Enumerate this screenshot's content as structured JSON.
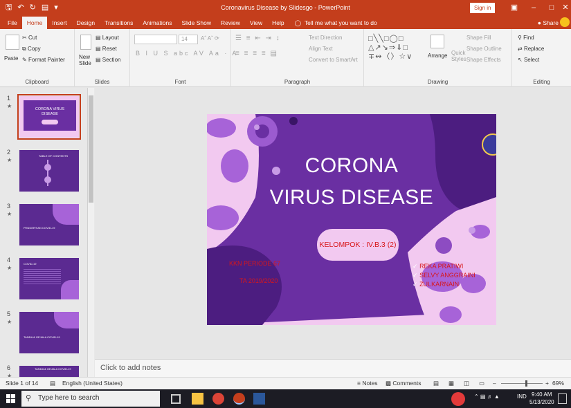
{
  "window": {
    "title": "Coronavirus Disease by Slidesgo  -  PowerPoint",
    "sign_in": "Sign in",
    "share": "Share"
  },
  "ribbon_tabs": [
    "File",
    "Home",
    "Insert",
    "Design",
    "Transitions",
    "Animations",
    "Slide Show",
    "Review",
    "View",
    "Help"
  ],
  "tell_me": "Tell me what you want to do",
  "ribbon": {
    "clipboard": {
      "paste": "Paste",
      "cut": "Cut",
      "copy": "Copy",
      "format_painter": "Format Painter",
      "label": "Clipboard"
    },
    "slides": {
      "new_slide": "New Slide",
      "layout": "Layout",
      "reset": "Reset",
      "section": "Section",
      "label": "Slides"
    },
    "font": {
      "size": "14",
      "label": "Font"
    },
    "paragraph": {
      "text_direction": "Text Direction",
      "align_text": "Align Text",
      "convert_smartart": "Convert to SmartArt",
      "label": "Paragraph"
    },
    "drawing": {
      "arrange": "Arrange",
      "quick_styles": "Quick Styles",
      "shape_fill": "Shape Fill",
      "shape_outline": "Shape Outline",
      "shape_effects": "Shape Effects",
      "label": "Drawing"
    },
    "editing": {
      "find": "Find",
      "replace": "Replace",
      "select": "Select",
      "label": "Editing"
    }
  },
  "thumbnails": [
    {
      "num": "1",
      "text": "CORONA VIRUS DISEASE"
    },
    {
      "num": "2",
      "text": "TABLE OF CONTENTS"
    },
    {
      "num": "3",
      "text": "PENGERTIAN COVID-19"
    },
    {
      "num": "4",
      "text": "COVID-19"
    },
    {
      "num": "5",
      "text": "TANDA & GEJALA COVID-19"
    },
    {
      "num": "6",
      "text": "TANDA & GEJALA COVID-19"
    }
  ],
  "slide": {
    "title_line1": "CORONA",
    "title_line2": "VIRUS DISEASE",
    "group": "KELOMPOK : IV.B.3 (2)",
    "kkn": "KKN PERIODE 67",
    "year": "TA 2019/2020",
    "members": [
      "REKA PRATIWI",
      "SELVY ANGGRAINI",
      "ZULKARNAIN"
    ]
  },
  "notes_placeholder": "Click to add notes",
  "status": {
    "slide_count": "Slide 1 of 14",
    "language": "English (United States)",
    "notes": "Notes",
    "comments": "Comments",
    "zoom": "69%"
  },
  "taskbar": {
    "search_placeholder": "Type here to search",
    "lang": "IND",
    "time": "9:40 AM",
    "date": "5/13/2020"
  },
  "colors": {
    "accent": "#c43e1c",
    "slide_purple": "#6a2fa2",
    "slide_pink": "#f2c9f0",
    "text_red": "#d8161a"
  }
}
